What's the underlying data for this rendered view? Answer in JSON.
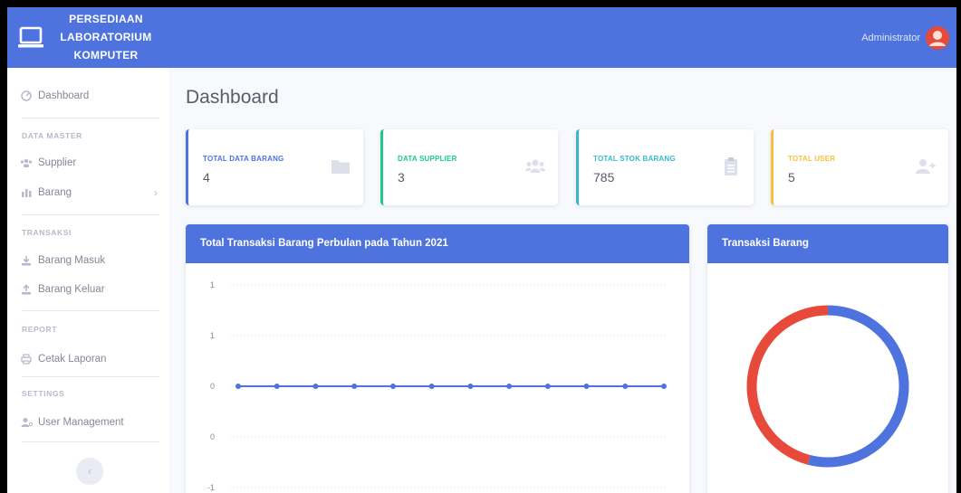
{
  "brand": {
    "lines": [
      "PERSEDIAAN",
      "LABORATORIUM",
      "KOMPUTER"
    ]
  },
  "topbar": {
    "user_name": "Administrator"
  },
  "sidebar": {
    "dashboard": "Dashboard",
    "headings": {
      "master": "DATA MASTER",
      "transaksi": "TRANSAKSI",
      "report": "REPORT",
      "settings": "SETTINGS"
    },
    "items": {
      "supplier": "Supplier",
      "barang": "Barang",
      "barang_masuk": "Barang Masuk",
      "barang_keluar": "Barang Keluar",
      "cetak_laporan": "Cetak Laporan",
      "user_management": "User Management"
    },
    "toggle_glyph": "‹"
  },
  "page": {
    "title": "Dashboard"
  },
  "cards": [
    {
      "label": "TOTAL DATA BARANG",
      "value": "4",
      "color": "#4e73df",
      "icon": "folder-icon"
    },
    {
      "label": "DATA SUPPLIER",
      "value": "3",
      "color": "#1cc88a",
      "icon": "users-icon"
    },
    {
      "label": "TOTAL STOK BARANG",
      "value": "785",
      "color": "#36b9cc",
      "icon": "clipboard-icon"
    },
    {
      "label": "TOTAL USER",
      "value": "5",
      "color": "#f6c23e",
      "icon": "user-plus-icon"
    }
  ],
  "line_panel": {
    "title": "Total Transaksi Barang Perbulan pada Tahun 2021"
  },
  "pie_panel": {
    "title": "Transaksi Barang"
  },
  "colors": {
    "primary": "#4e73df",
    "danger": "#e74a3b"
  },
  "chart_data": [
    {
      "type": "line",
      "ytick_labels": [
        "1",
        "1",
        "0",
        "0",
        "-1"
      ],
      "series": [
        {
          "values": [
            0,
            0,
            0,
            0,
            0,
            0,
            0,
            0,
            0,
            0,
            0,
            0
          ],
          "color": "#4e73df"
        }
      ],
      "grid": true
    },
    {
      "type": "pie",
      "donut": true,
      "slices": [
        {
          "value": 0.54,
          "color": "#4e73df"
        },
        {
          "value": 0.46,
          "color": "#e74a3b"
        }
      ]
    }
  ]
}
